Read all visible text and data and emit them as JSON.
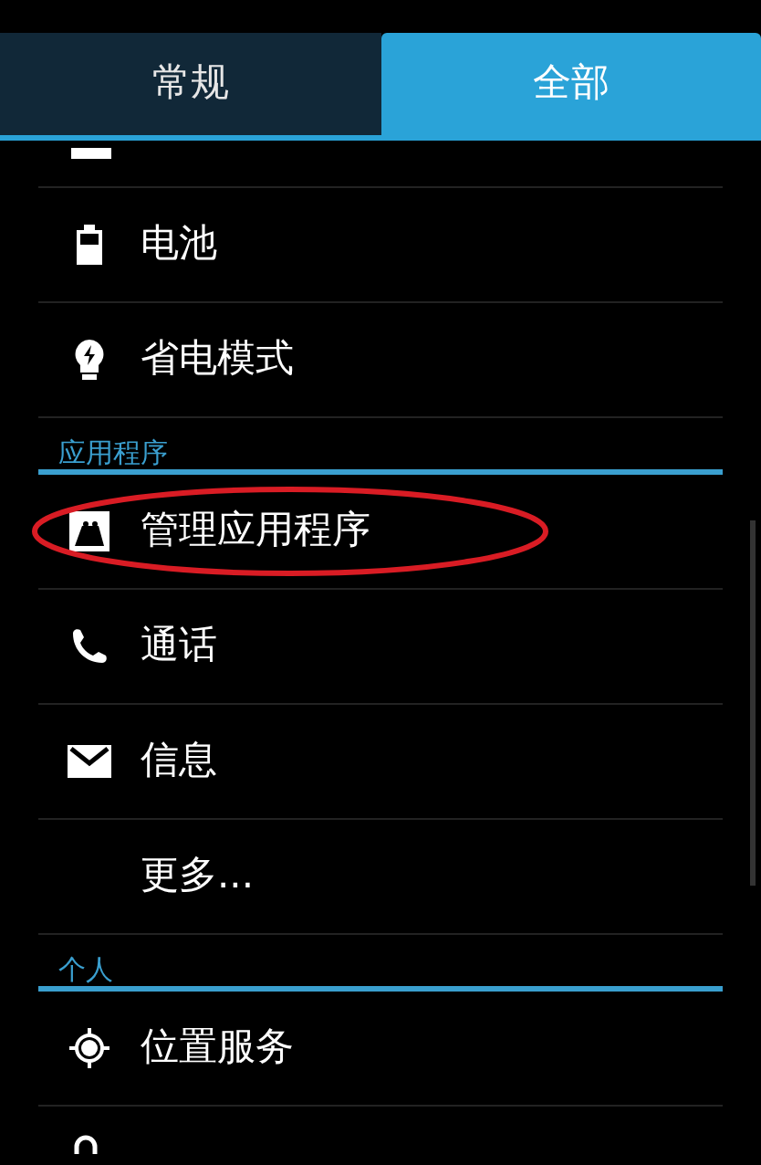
{
  "tabs": [
    {
      "label": "常规",
      "selected": false
    },
    {
      "label": "全部",
      "selected": true
    }
  ],
  "list": [
    {
      "kind": "partial"
    },
    {
      "kind": "item",
      "label": "电池",
      "highlighted": false
    },
    {
      "kind": "item",
      "label": "省电模式",
      "highlighted": false
    },
    {
      "kind": "header",
      "label": "应用程序"
    },
    {
      "kind": "item",
      "label": "管理应用程序",
      "highlighted": true
    },
    {
      "kind": "item",
      "label": "通话",
      "highlighted": false
    },
    {
      "kind": "item",
      "label": "信息",
      "highlighted": false
    },
    {
      "kind": "item",
      "label": "更多...",
      "highlighted": false
    },
    {
      "kind": "header",
      "label": "个人"
    },
    {
      "kind": "item",
      "label": "位置服务",
      "highlighted": false
    },
    {
      "kind": "cut"
    }
  ]
}
